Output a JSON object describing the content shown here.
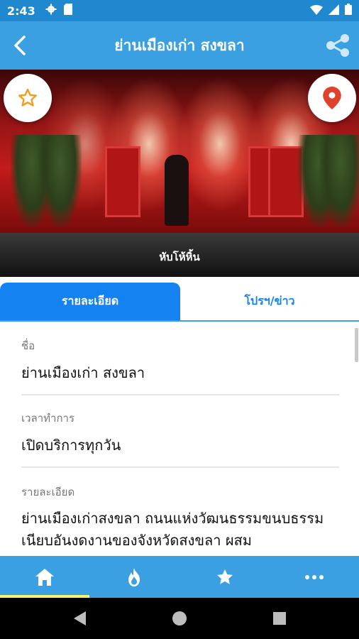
{
  "status_bar": {
    "time": "2:43",
    "icons": [
      "gear-icon",
      "sd-card-icon",
      "wifi-icon",
      "signal-icon",
      "battery-icon"
    ]
  },
  "app_bar": {
    "title": "ย่านเมืองเก่า สงขลา",
    "back_icon": "chevron-left-icon",
    "share_icon": "share-icon"
  },
  "hero": {
    "caption": "หับโห้หิ้น",
    "favorite_icon": "star-outline-icon",
    "location_icon": "map-pin-icon"
  },
  "tabs": [
    {
      "label": "รายละเอียด",
      "active": true
    },
    {
      "label": "โปรฯ/ข่าว",
      "active": false
    }
  ],
  "details": {
    "name": {
      "label": "ชื่อ",
      "value": "ย่านเมืองเก่า สงขลา"
    },
    "hours": {
      "label": "เวลาทำการ",
      "value": "เปิดบริการทุกวัน"
    },
    "description": {
      "label": "รายละเอียด",
      "value": "ย่านเมืองเก่าสงขลา ถนนแห่งวัฒนธรรมขนบธรรมเนียบอันงดงานของจังหวัดสงขลา ผสม"
    }
  },
  "bottom_nav": [
    {
      "icon": "home-icon",
      "active": true
    },
    {
      "icon": "flame-icon",
      "active": false
    },
    {
      "icon": "star-icon",
      "active": false
    },
    {
      "icon": "more-icon",
      "active": false
    }
  ],
  "colors": {
    "primary": "#3aa0e2",
    "status_bar": "#1f88cf",
    "tab_active": "#1482f0",
    "nav_indicator": "#f6f36a",
    "star_orange": "#f0a020",
    "pin_red": "#e0412b"
  }
}
